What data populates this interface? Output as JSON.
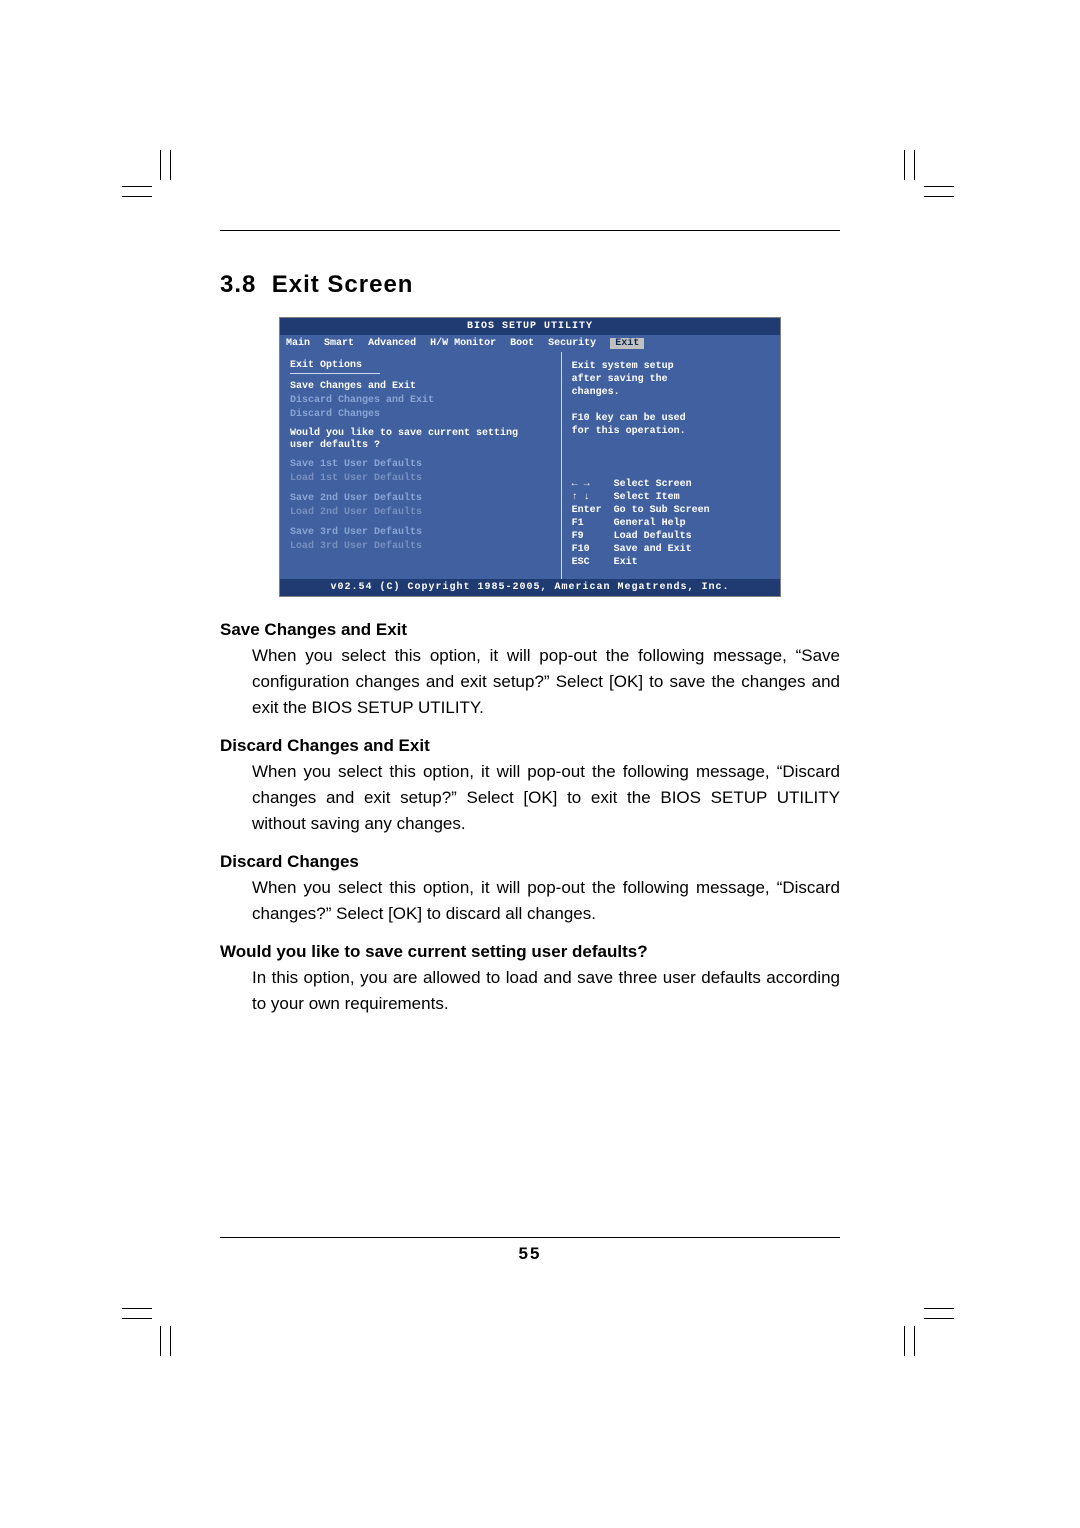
{
  "section_number": "3.8",
  "section_title": "Exit Screen",
  "bios": {
    "title": "BIOS SETUP UTILITY",
    "tabs": [
      "Main",
      "Smart",
      "Advanced",
      "H/W Monitor",
      "Boot",
      "Security",
      "Exit"
    ],
    "active_tab": "Exit",
    "left_heading": "Exit Options",
    "options": [
      {
        "label": "Save Changes and Exit",
        "selected": true
      },
      {
        "label": "Discard Changes and Exit",
        "selected": false
      },
      {
        "label": "Discard Changes",
        "selected": false
      }
    ],
    "question_line1": "Would you like to save current setting",
    "question_line2": "user defaults ?",
    "user_defaults": [
      {
        "save": "Save 1st User Defaults",
        "load": "Load 1st User Defaults"
      },
      {
        "save": "Save 2nd User Defaults",
        "load": "Load 2nd User Defaults"
      },
      {
        "save": "Save 3rd User Defaults",
        "load": "Load 3rd User Defaults"
      }
    ],
    "help": {
      "desc_line1": "Exit system setup",
      "desc_line2": "after saving the",
      "desc_line3": "changes.",
      "desc_line4": "F10 key can be used",
      "desc_line5": "for this operation."
    },
    "keys": [
      {
        "key": "← →",
        "action": "Select Screen"
      },
      {
        "key": "↑ ↓",
        "action": "Select Item"
      },
      {
        "key": "Enter",
        "action": "Go to Sub Screen"
      },
      {
        "key": "F1",
        "action": "General Help"
      },
      {
        "key": "F9",
        "action": "Load Defaults"
      },
      {
        "key": "F10",
        "action": "Save and Exit"
      },
      {
        "key": "ESC",
        "action": "Exit"
      }
    ],
    "footer": "v02.54 (C) Copyright 1985-2005, American Megatrends, Inc."
  },
  "descriptions": [
    {
      "heading": "Save Changes and Exit",
      "text": "When you select this option, it will pop-out the following message, “Save configuration changes and exit setup?” Select [OK] to save the changes and exit the BIOS SETUP UTILITY."
    },
    {
      "heading": "Discard Changes and Exit",
      "text": "When you select this option, it will pop-out the following message, “Discard changes and exit setup?” Select [OK] to exit the BIOS SETUP UTILITY without saving any changes."
    },
    {
      "heading": "Discard Changes",
      "text": "When you select this option, it will pop-out the following message, “Discard changes?” Select [OK] to discard all changes."
    },
    {
      "heading": "Would you like to save current setting user defaults?",
      "text": "In this option, you are allowed to load and save three user defaults according to your own requirements."
    }
  ],
  "page_number": "55"
}
